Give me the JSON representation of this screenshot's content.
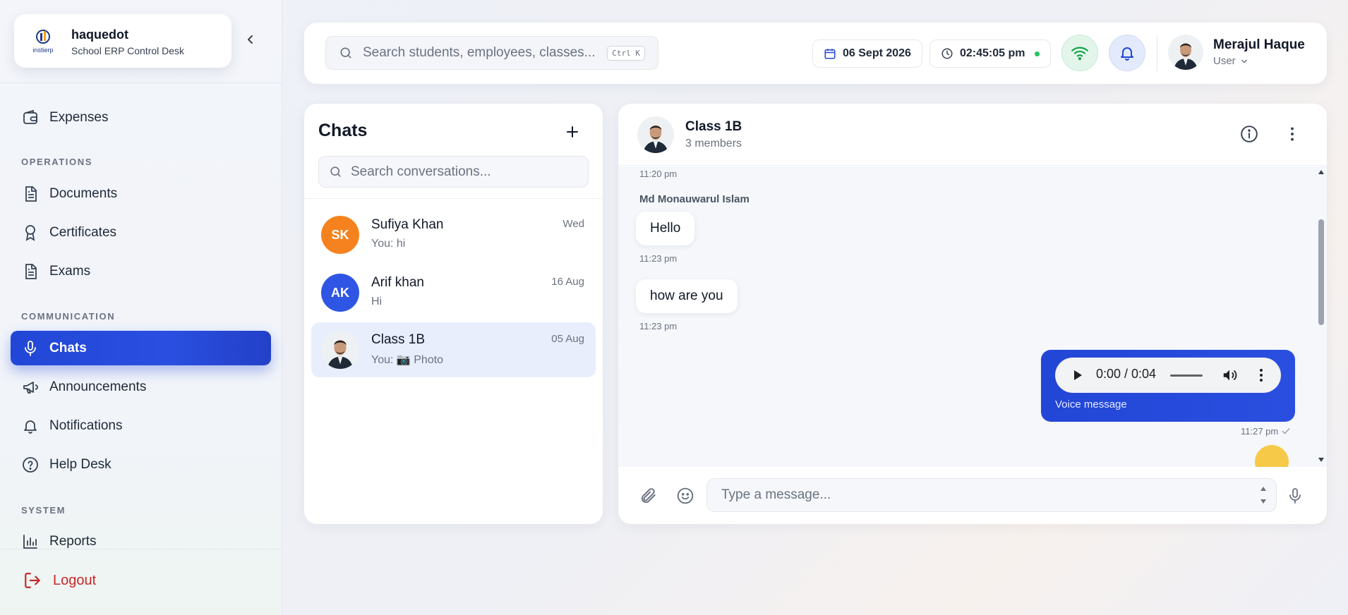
{
  "brand": {
    "name": "haquedot",
    "subtitle": "School ERP Control Desk",
    "logo_text": "instierp"
  },
  "sidebar": {
    "items_top": [
      {
        "label": "Expenses",
        "icon": "wallet-icon"
      }
    ],
    "sections": [
      {
        "title": "OPERATIONS",
        "items": [
          {
            "label": "Documents",
            "icon": "document-icon"
          },
          {
            "label": "Certificates",
            "icon": "award-icon"
          },
          {
            "label": "Exams",
            "icon": "file-text-icon"
          }
        ]
      },
      {
        "title": "COMMUNICATION",
        "items": [
          {
            "label": "Chats",
            "icon": "mic-icon",
            "active": true
          },
          {
            "label": "Announcements",
            "icon": "megaphone-icon"
          },
          {
            "label": "Notifications",
            "icon": "bell-icon"
          },
          {
            "label": "Help Desk",
            "icon": "help-circle-icon"
          }
        ]
      },
      {
        "title": "SYSTEM",
        "items": [
          {
            "label": "Reports",
            "icon": "bar-chart-icon"
          }
        ]
      }
    ],
    "logout_label": "Logout"
  },
  "topbar": {
    "search_placeholder": "Search students, employees, classes...",
    "search_shortcut": "Ctrl K",
    "date": "06 Sept 2026",
    "time": "02:45:05 pm",
    "user_name": "Merajul Haque",
    "user_role": "User"
  },
  "chats": {
    "title": "Chats",
    "search_placeholder": "Search conversations...",
    "conversations": [
      {
        "initials": "SK",
        "name": "Sufiya Khan",
        "preview": "You: hi",
        "date": "Wed",
        "color": "#f5821f"
      },
      {
        "initials": "AK",
        "name": "Arif khan",
        "preview": "Hi",
        "date": "16 Aug",
        "color": "#2f55e4"
      },
      {
        "initials": "",
        "name": "Class 1B",
        "preview": "You: 📷 Photo",
        "date": "05 Aug",
        "active": true
      }
    ]
  },
  "chat": {
    "name": "Class 1B",
    "members": "3 members",
    "messages": {
      "first_time": "11:20 pm",
      "sender": "Md Monauwarul Islam",
      "msg1": "Hello",
      "msg1_time": "11:23 pm",
      "msg2": "how are you",
      "msg2_time": "11:23 pm",
      "voice_time": "0:00 / 0:04",
      "voice_label": "Voice message",
      "voice_sent_time": "11:27 pm"
    },
    "composer_placeholder": "Type a message..."
  },
  "colors": {
    "accent": "#2246d6",
    "logout": "#c62828",
    "online": "#22c55e"
  }
}
